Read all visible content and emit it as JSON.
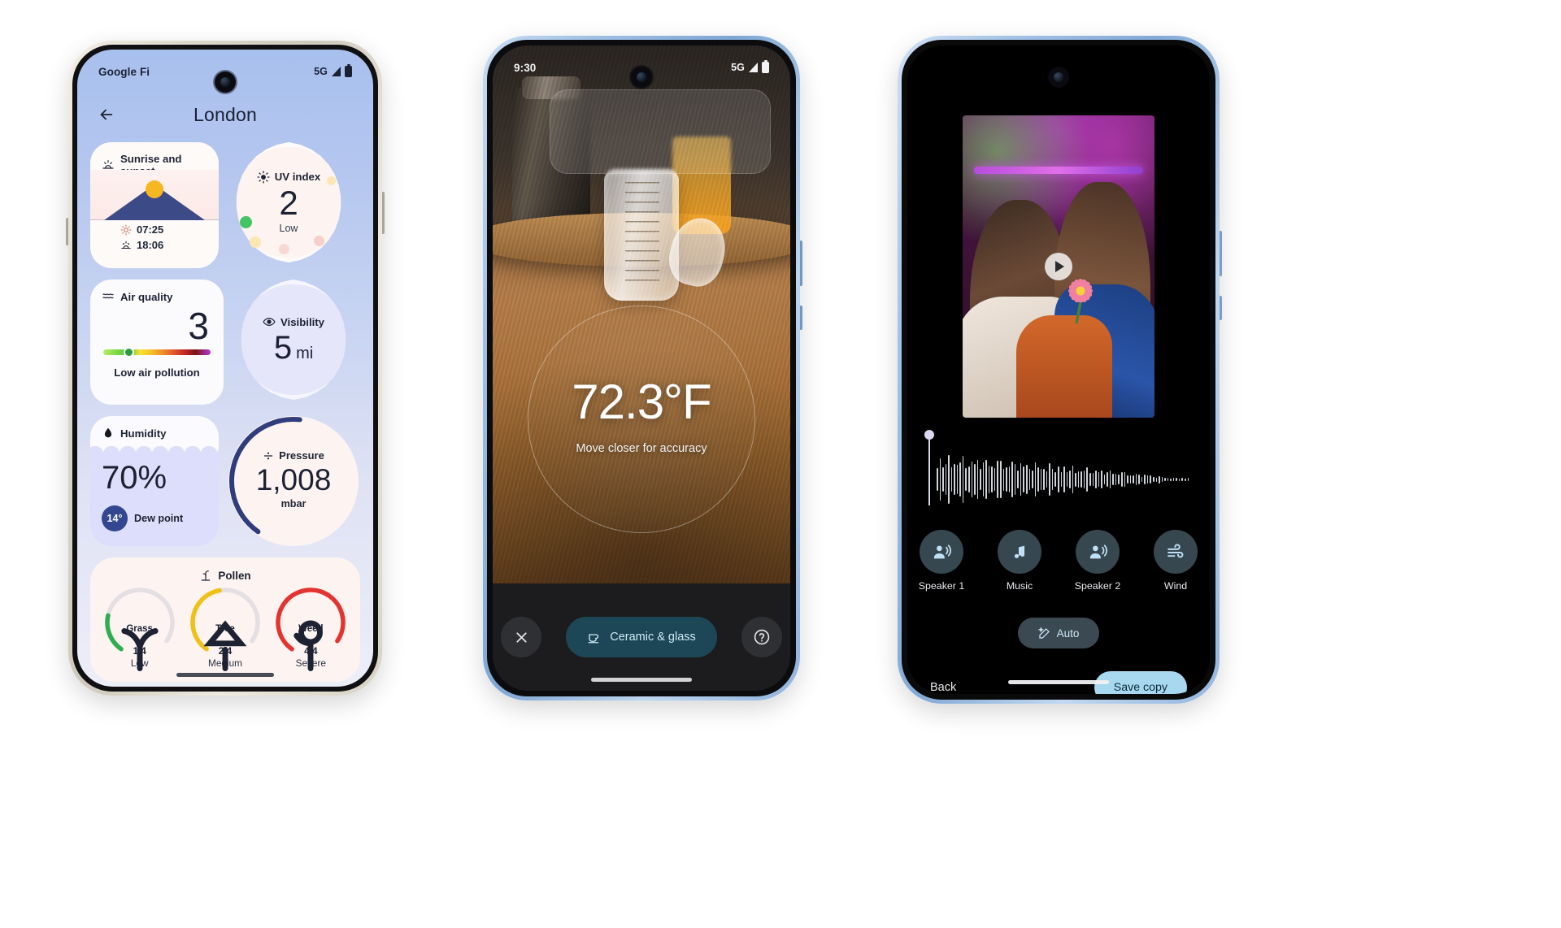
{
  "phone1": {
    "status": {
      "carrier": "Google Fi",
      "network": "5G"
    },
    "topbar": {
      "back_icon": "arrow-back-icon",
      "title": "London"
    },
    "sunrise": {
      "title": "Sunrise and sunset",
      "icon": "sunrise-icon",
      "sunrise_time": "07:25",
      "sunset_time": "18:06",
      "sunrise_icon": "sun-icon",
      "sunset_icon": "sunset-icon"
    },
    "uv": {
      "title": "UV index",
      "icon": "sun-bright-icon",
      "value": "2",
      "level": "Low",
      "dot_color": "#45c463"
    },
    "air": {
      "title": "Air quality",
      "icon": "air-waves-icon",
      "value": "3",
      "label": "Low air pollution",
      "indicator_position_pct": 24
    },
    "visibility": {
      "title": "Visibility",
      "icon": "eye-icon",
      "value": "5",
      "unit": "mi"
    },
    "humidity": {
      "title": "Humidity",
      "icon": "droplet-icon",
      "value": "70%",
      "dew_point_value": "14°",
      "dew_point_label": "Dew point"
    },
    "pressure": {
      "title": "Pressure",
      "icon": "pressure-icon",
      "value": "1,008",
      "unit": "mbar"
    },
    "pollen": {
      "title": "Pollen",
      "icon": "pollen-icon",
      "items": [
        {
          "name": "Grass",
          "icon": "grass-icon",
          "ratio": "1/4",
          "level": "Low",
          "color": "#2fae4f",
          "arc_pct": 25
        },
        {
          "name": "Tree",
          "icon": "tree-icon",
          "ratio": "2/4",
          "level": "Medium",
          "color": "#efc117",
          "arc_pct": 50
        },
        {
          "name": "Weed",
          "icon": "weed-icon",
          "ratio": "4/4",
          "level": "Severe",
          "color": "#e4342f",
          "arc_pct": 100
        }
      ]
    }
  },
  "phone2": {
    "status": {
      "time": "9:30",
      "network": "5G"
    },
    "reading": {
      "temperature": "72.3°F",
      "hint": "Move closer for accuracy"
    },
    "controls": {
      "close_icon": "close-icon",
      "material_label": "Ceramic & glass",
      "material_icon": "material-icon",
      "help_icon": "help-circle-icon"
    }
  },
  "phone3": {
    "media": {
      "play_icon": "play-icon"
    },
    "tools": [
      {
        "label": "Speaker 1",
        "icon": "speaker-person-icon"
      },
      {
        "label": "Music",
        "icon": "music-note-icon"
      },
      {
        "label": "Speaker 2",
        "icon": "speaker-person-icon"
      },
      {
        "label": "Wind",
        "icon": "wind-icon"
      }
    ],
    "auto": {
      "label": "Auto",
      "icon": "magic-wand-icon"
    },
    "footer": {
      "back_label": "Back",
      "save_label": "Save copy"
    }
  }
}
